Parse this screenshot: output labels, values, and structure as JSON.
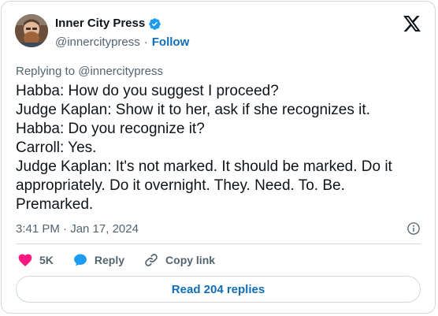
{
  "author": {
    "display_name": "Inner City Press",
    "handle": "@innercitypress",
    "separator": "·",
    "follow_label": "Follow",
    "verified_color": "#1d9bf0"
  },
  "header": {
    "logo_icon": "x-logo-icon"
  },
  "tweet": {
    "replying_to": "Replying to @innercitypress",
    "lines": [
      "Habba: How do you suggest I proceed?",
      "Judge Kaplan: Show it to her, ask if she recognizes it.",
      "Habba: Do you recognize it?",
      "Carroll: Yes.",
      "Judge Kaplan: It's not marked. It should be marked. Do it",
      "appropriately. Do it overnight. They. Need. To. Be.",
      "Premarked."
    ],
    "timestamp": "3:41 PM · Jan 17, 2024"
  },
  "actions": {
    "like_count": "5K",
    "reply_label": "Reply",
    "copy_link_label": "Copy link",
    "like_color": "#f91880",
    "reply_color": "#1d9bf0"
  },
  "read_replies": "Read 204 replies"
}
